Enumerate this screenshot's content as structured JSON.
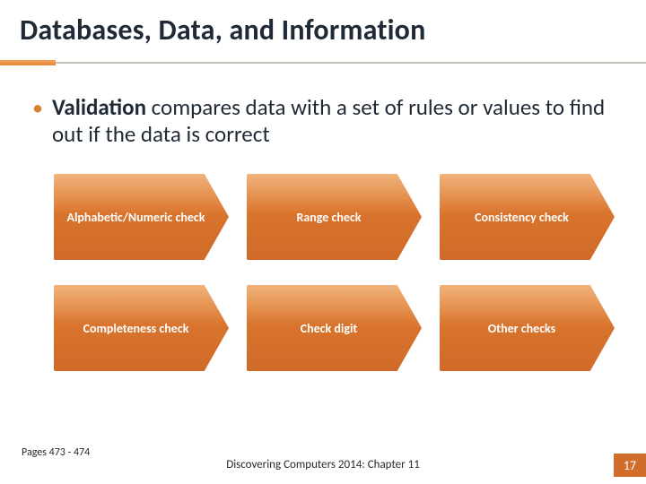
{
  "title": "Databases, Data, and Information",
  "bullet": {
    "bold": "Validation",
    "rest": " compares data with a set of rules or values to find out if the data is correct"
  },
  "boxes": [
    "Alphabetic/Numeric check",
    "Range check",
    "Consistency check",
    "Completeness check",
    "Check digit",
    "Other checks"
  ],
  "pages_ref": "Pages 473 - 474",
  "footer": "Discovering Computers 2014: Chapter 11",
  "slide_number": "17"
}
